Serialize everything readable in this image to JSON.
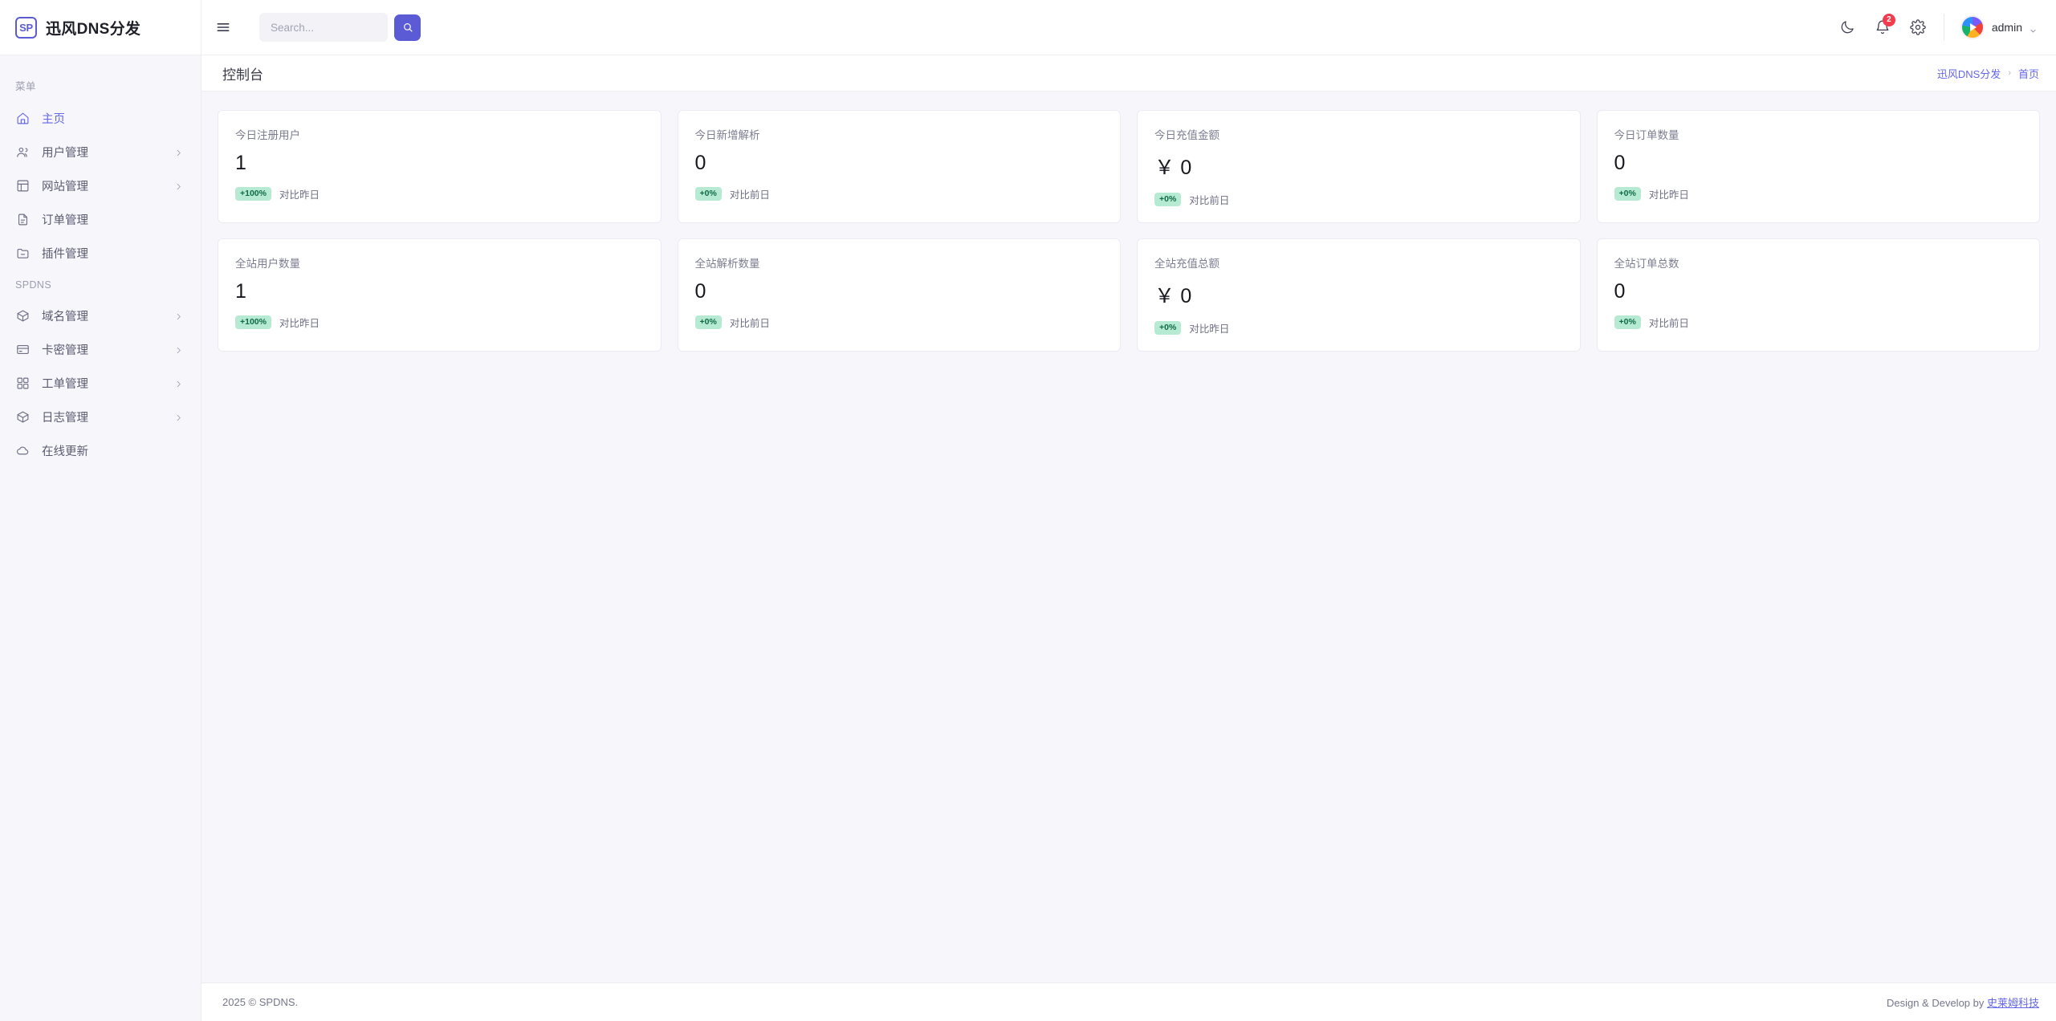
{
  "brand": {
    "logo_text": "SP",
    "title": "迅风DNS分发"
  },
  "search": {
    "placeholder": "Search...",
    "value": ""
  },
  "topbar": {
    "theme_toggle_title": "",
    "notification_count": "2",
    "user_name": "admin"
  },
  "sidebar": {
    "sections": [
      {
        "caption": "菜单",
        "items": [
          {
            "label": "主页",
            "icon": "home-icon",
            "active": true,
            "expandable": false
          },
          {
            "label": "用户管理",
            "icon": "users-icon",
            "active": false,
            "expandable": true
          },
          {
            "label": "网站管理",
            "icon": "layout-icon",
            "active": false,
            "expandable": true
          },
          {
            "label": "订单管理",
            "icon": "file-text-icon",
            "active": false,
            "expandable": false
          },
          {
            "label": "插件管理",
            "icon": "folder-minus-icon",
            "active": false,
            "expandable": false
          }
        ]
      },
      {
        "caption": "SPDNS",
        "items": [
          {
            "label": "域名管理",
            "icon": "box-icon",
            "active": false,
            "expandable": true
          },
          {
            "label": "卡密管理",
            "icon": "credit-card-icon",
            "active": false,
            "expandable": true
          },
          {
            "label": "工单管理",
            "icon": "grid-icon",
            "active": false,
            "expandable": true
          },
          {
            "label": "日志管理",
            "icon": "package-icon",
            "active": false,
            "expandable": true
          },
          {
            "label": "在线更新",
            "icon": "cloud-icon",
            "active": false,
            "expandable": false
          }
        ]
      }
    ]
  },
  "page": {
    "title": "控制台",
    "breadcrumb": {
      "root": "迅风DNS分发",
      "separator": "›",
      "current": "首页"
    }
  },
  "cards": [
    {
      "label": "今日注册用户",
      "value": "1",
      "badge": "+100%",
      "compare": "对比昨日"
    },
    {
      "label": "今日新增解析",
      "value": "0",
      "badge": "+0%",
      "compare": "对比前日"
    },
    {
      "label": "今日充值金额",
      "value": "￥ 0",
      "badge": "+0%",
      "compare": "对比前日"
    },
    {
      "label": "今日订单数量",
      "value": "0",
      "badge": "+0%",
      "compare": "对比昨日"
    },
    {
      "label": "全站用户数量",
      "value": "1",
      "badge": "+100%",
      "compare": "对比昨日"
    },
    {
      "label": "全站解析数量",
      "value": "0",
      "badge": "+0%",
      "compare": "对比前日"
    },
    {
      "label": "全站充值总额",
      "value": "￥ 0",
      "badge": "+0%",
      "compare": "对比昨日"
    },
    {
      "label": "全站订单总数",
      "value": "0",
      "badge": "+0%",
      "compare": "对比前日"
    }
  ],
  "footer": {
    "copyright": "2025 © SPDNS.",
    "credit_prefix": "Design & Develop by ",
    "credit_link": "史莱姆科技"
  },
  "colors": {
    "accent": "#5b5bd6",
    "accent_text": "#6366e8",
    "badge_bg": "#b7ead2",
    "badge_text": "#0e6b45",
    "notification_badge": "#f23c4e",
    "sidebar_bg": "#f7f7fb",
    "content_bg": "#f7f7fb"
  }
}
